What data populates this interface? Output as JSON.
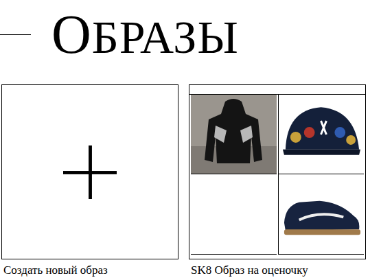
{
  "page": {
    "title": "ОБРАЗЫ"
  },
  "create_card": {
    "label": "Создать новый образ"
  },
  "outfits": [
    {
      "title": "SK8 Образ на оценочку",
      "slots": [
        {
          "kind": "hoodie"
        },
        {
          "kind": "cap"
        },
        {
          "kind": "empty"
        },
        {
          "kind": "shoes"
        }
      ]
    }
  ]
}
